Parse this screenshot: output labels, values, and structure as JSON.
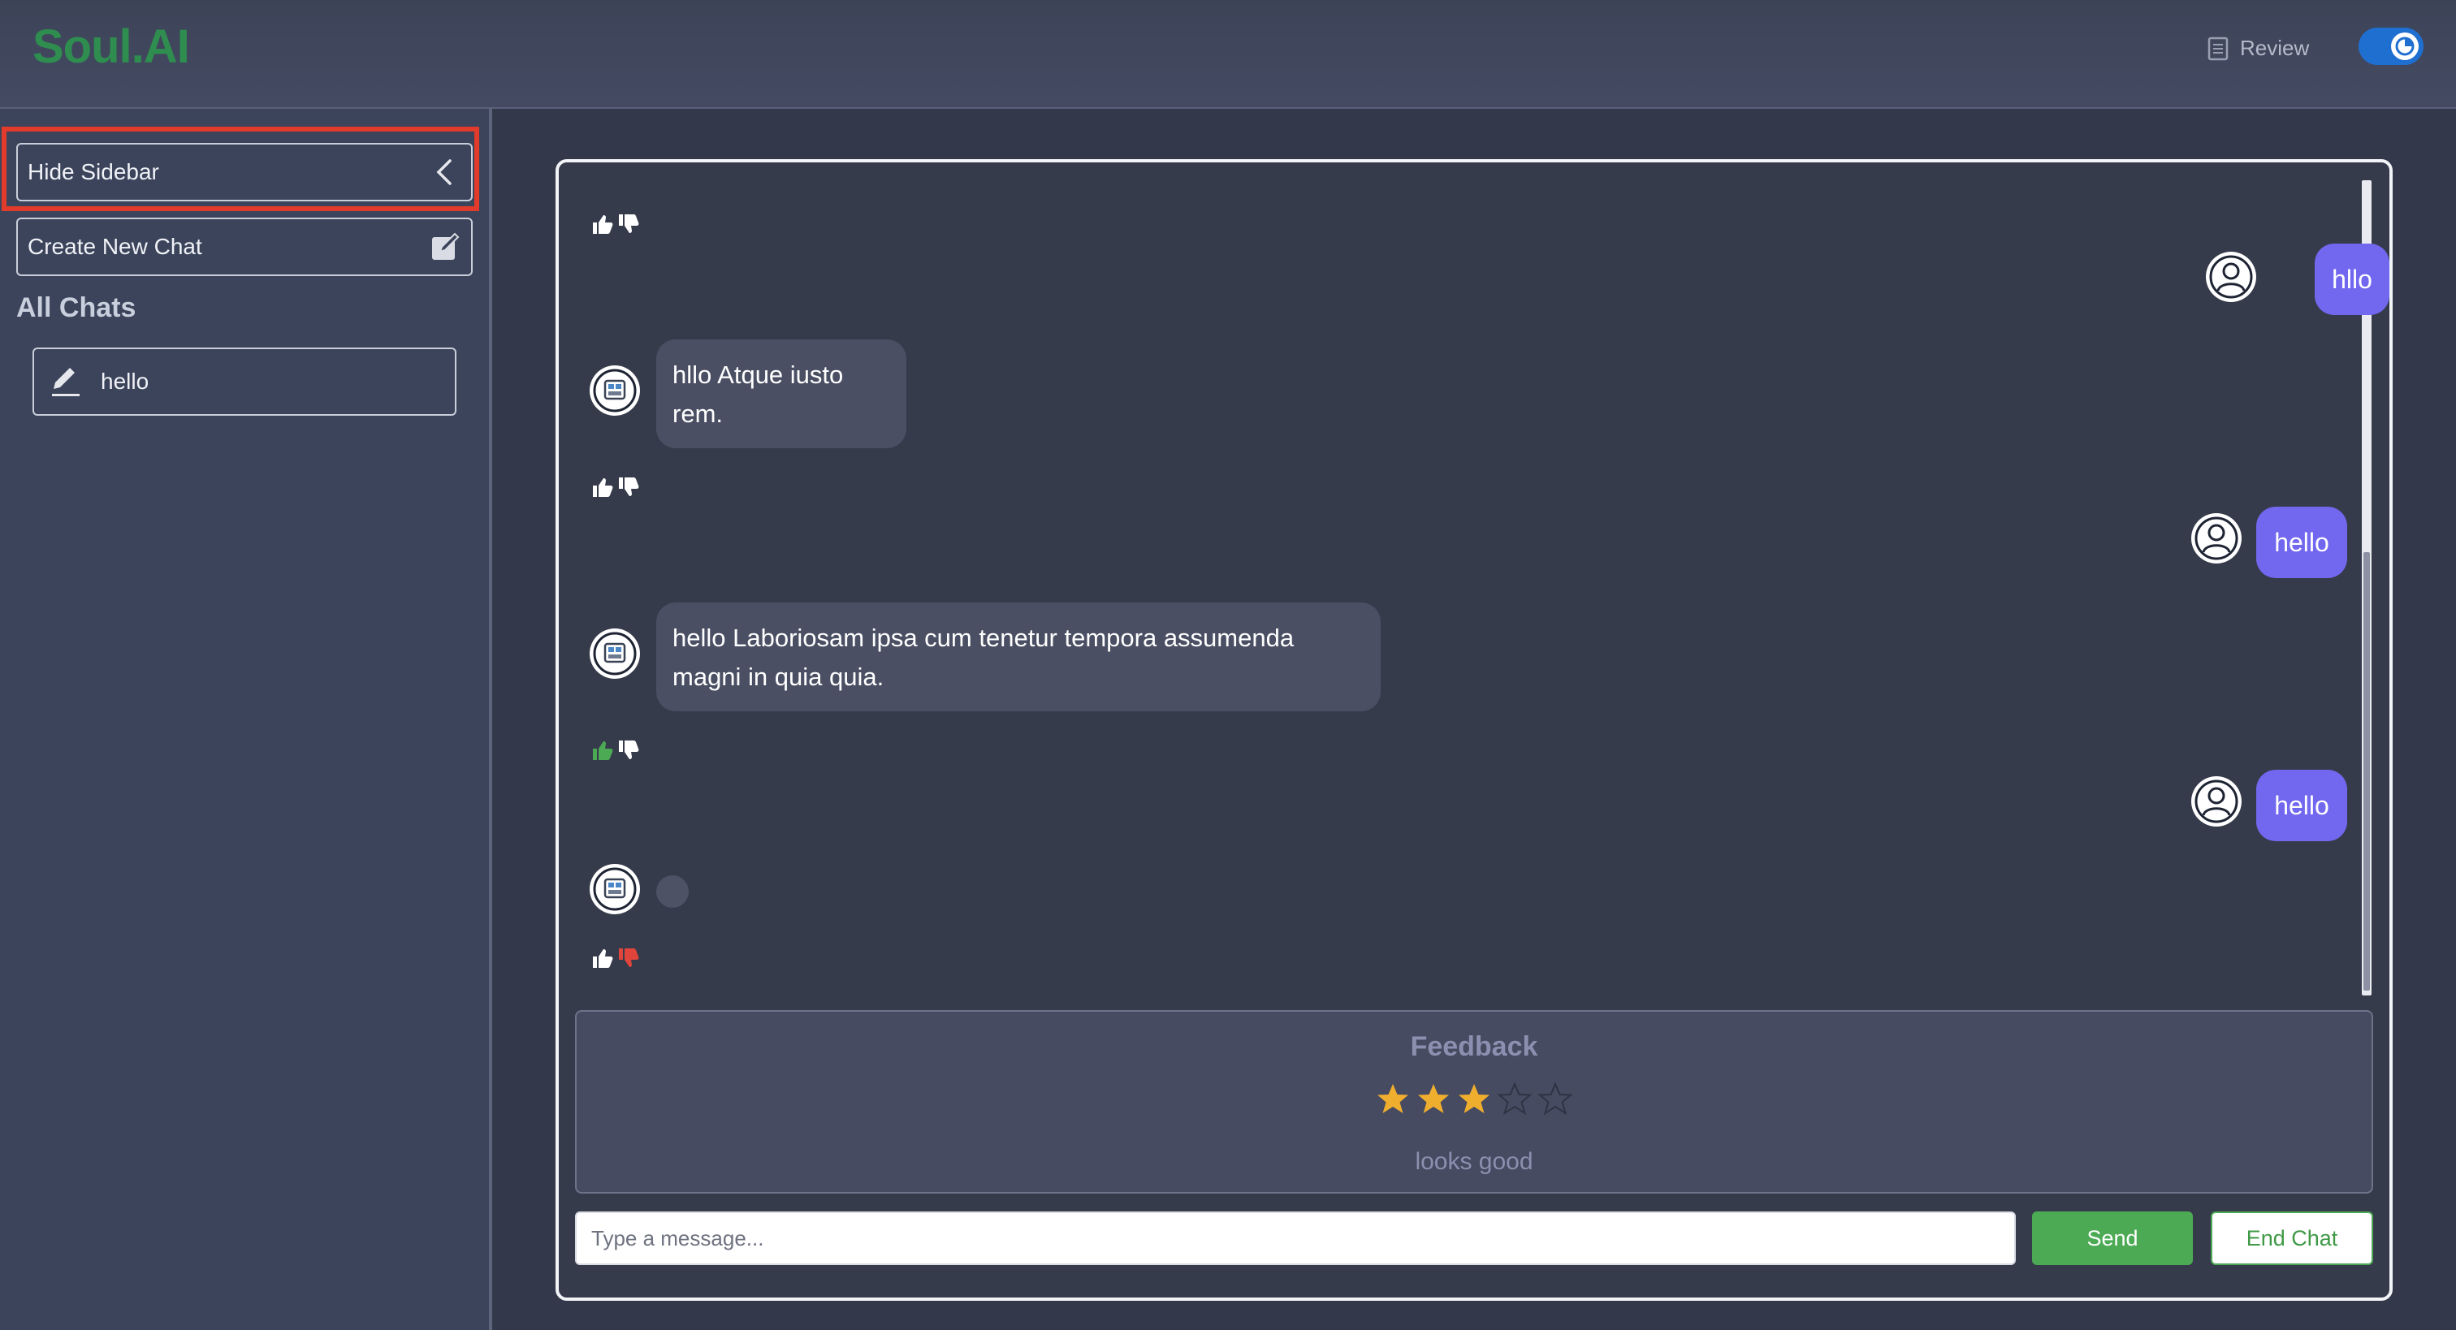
{
  "header": {
    "logo": "Soul.AI",
    "review_label": "Review",
    "review_icon": "document-icon",
    "theme_toggle_icon": "moon-icon"
  },
  "sidebar": {
    "hide_label": "Hide Sidebar",
    "hide_icon": "chevron-left-icon",
    "new_chat_label": "Create New Chat",
    "new_chat_icon": "edit-square-icon",
    "all_chats_heading": "All Chats",
    "chats": [
      {
        "title": "hello",
        "icon": "pencil-icon"
      }
    ]
  },
  "conversation": {
    "messages": [
      {
        "role": "user",
        "text": "hllo"
      },
      {
        "role": "bot",
        "text": "hllo Atque iusto rem.",
        "feedback": "none"
      },
      {
        "role": "user",
        "text": "hello"
      },
      {
        "role": "bot",
        "text": "hello Laboriosam ipsa cum tenetur tempora assumenda magni in quia quia.",
        "feedback": "like"
      },
      {
        "role": "user",
        "text": "hello"
      },
      {
        "role": "bot",
        "text": "",
        "feedback": "dislike",
        "status": "typing"
      }
    ]
  },
  "feedback": {
    "title": "Feedback",
    "rating": 3,
    "max_rating": 5,
    "comment": "looks good"
  },
  "composer": {
    "placeholder": "Type a message...",
    "value": "",
    "send_label": "Send",
    "end_label": "End Chat"
  },
  "colors": {
    "accent_green": "#4caa54",
    "user_bubble": "#7267ef",
    "star_filled": "#f0ae2e",
    "dislike_active": "#e0443a",
    "like_active": "#4caa54",
    "highlight_box": "#e23b2b"
  }
}
